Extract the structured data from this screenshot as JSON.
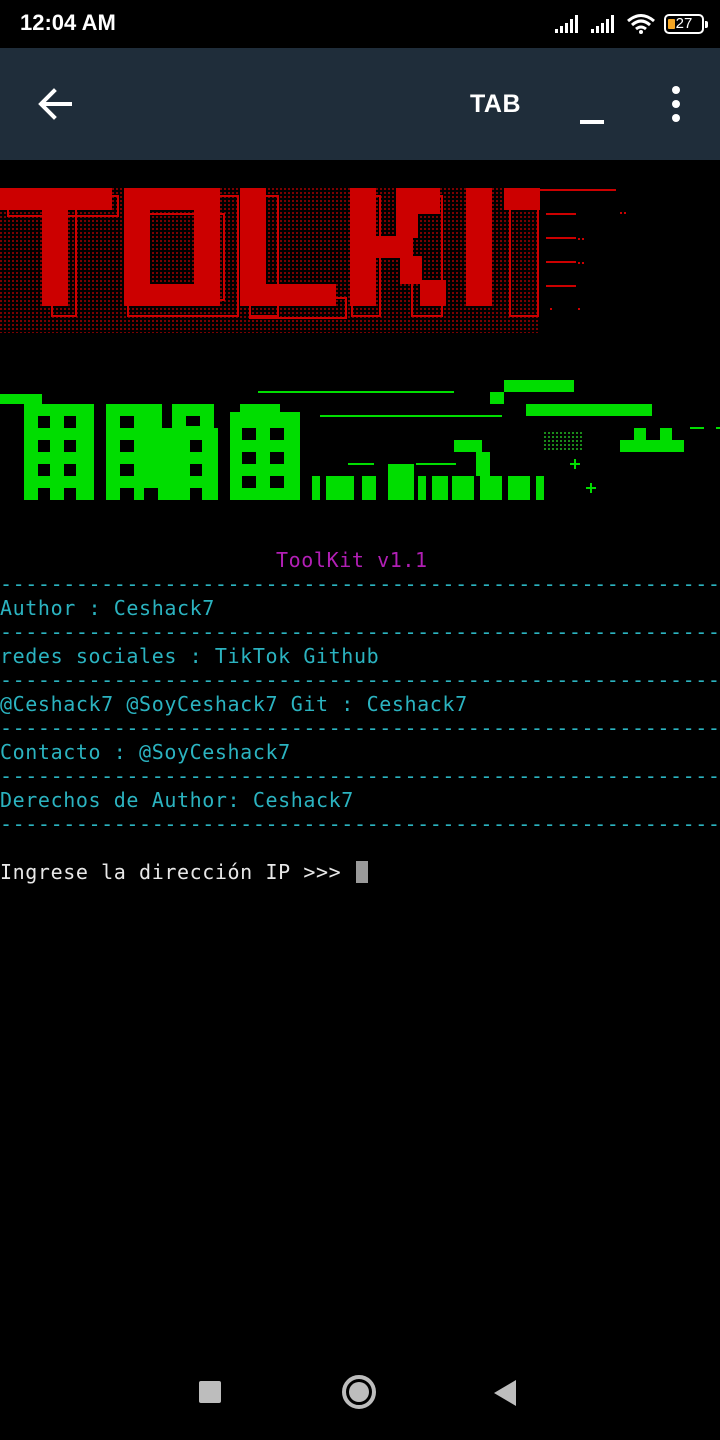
{
  "status_bar": {
    "time": "12:04 AM",
    "battery": "27",
    "icons": [
      "signal-icon",
      "signal-icon",
      "wifi-icon",
      "battery-icon"
    ]
  },
  "app_bar": {
    "tab_label": "TAB",
    "icons": [
      "back-arrow-icon",
      "minimize-icon",
      "more-vert-icon"
    ]
  },
  "terminal": {
    "banner_red_text": "TOLKI",
    "title": "ToolKit v1.1",
    "separator": "----------------------------------------------------------",
    "separator_long": "-----------------------------------------------------------",
    "lines": [
      "Author : Ceshack7",
      "redes sociales : TikTok Github",
      "@Ceshack7 @SoyCeshack7 Git : Ceshack7",
      "Contacto : @SoyCeshack7",
      "Derechos de Author: Ceshack7"
    ],
    "prompt": "Ingrese la dirección IP >>> ",
    "colors": {
      "banner_red": "#cc0000",
      "banner_green": "#00dd00",
      "cyan": "#2bb3c0",
      "magenta": "#b21fb5"
    }
  },
  "nav_bar": {
    "icons": [
      "recents-square-icon",
      "home-circle-icon",
      "back-triangle-icon"
    ]
  }
}
